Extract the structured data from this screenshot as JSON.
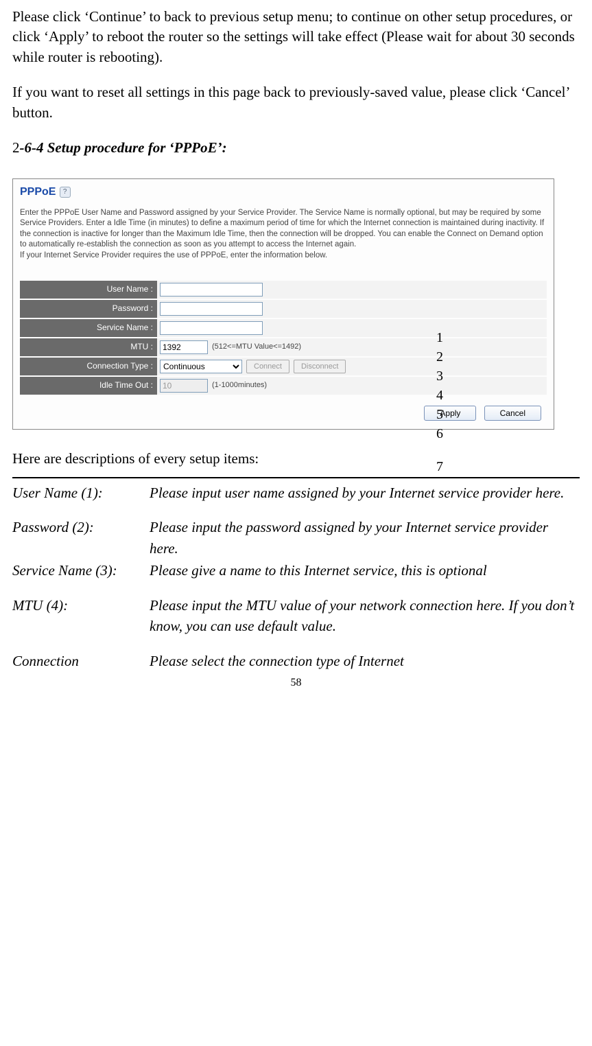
{
  "p1": "Please click ‘Continue’ to back to previous setup menu; to continue on other setup procedures, or click ‘Apply’ to reboot the router so the settings will take effect (Please wait for about 30 seconds while router is rebooting).",
  "p2": "If you want to reset all settings in this page back to previously-saved value, please click ‘Cancel’ button.",
  "heading_prefix": "2",
  "heading_title": "-6-4 Setup procedure for ‘PPPoE’:",
  "pppoe": {
    "title": "PPPoE",
    "intro": "Enter the PPPoE User Name and Password assigned by your Service Provider. The Service Name is normally optional, but may be required by some Service Providers. Enter a Idle Time (in minutes) to define a maximum period of time for which the Internet connection is maintained during inactivity. If the connection is inactive for longer than the Maximum Idle Time, then the connection will be dropped. You can enable the Connect on Demand option to automatically re-establish the connection as soon as you attempt to access the Internet again.\nIf your Internet Service Provider requires the use of PPPoE, enter the information below.",
    "fields": {
      "user_name_label": "User Name :",
      "password_label": "Password :",
      "service_name_label": "Service Name :",
      "mtu_label": "MTU :",
      "mtu_value": "1392",
      "mtu_hint": "(512<=MTU Value<=1492)",
      "conn_type_label": "Connection Type :",
      "conn_type_value": "Continuous",
      "connect_label": "Connect",
      "disconnect_label": "Disconnect",
      "idle_label": "Idle Time Out :",
      "idle_value": "10",
      "idle_hint": "(1-1000minutes)"
    },
    "apply": "Apply",
    "cancel": "Cancel"
  },
  "annotations": [
    "1",
    "2",
    "3",
    "4",
    "5",
    "6",
    "7"
  ],
  "desc_intro": "Here are descriptions of every setup items:",
  "descriptions": [
    {
      "term": "User Name (1):",
      "text": "Please input user name assigned by your Internet service provider here."
    },
    {
      "term": "Password (2):",
      "text": "Please input the password assigned by your Internet service provider here."
    },
    {
      "term": "Service Name (3):",
      "text": "Please give a name to this Internet service, this is optional"
    },
    {
      "term": "MTU (4):",
      "text": "Please input the MTU value of your network connection here. If you don’t know, you can use default value."
    },
    {
      "term": "Connection",
      "text": "Please select the connection type of Internet"
    }
  ],
  "page_number": "58"
}
